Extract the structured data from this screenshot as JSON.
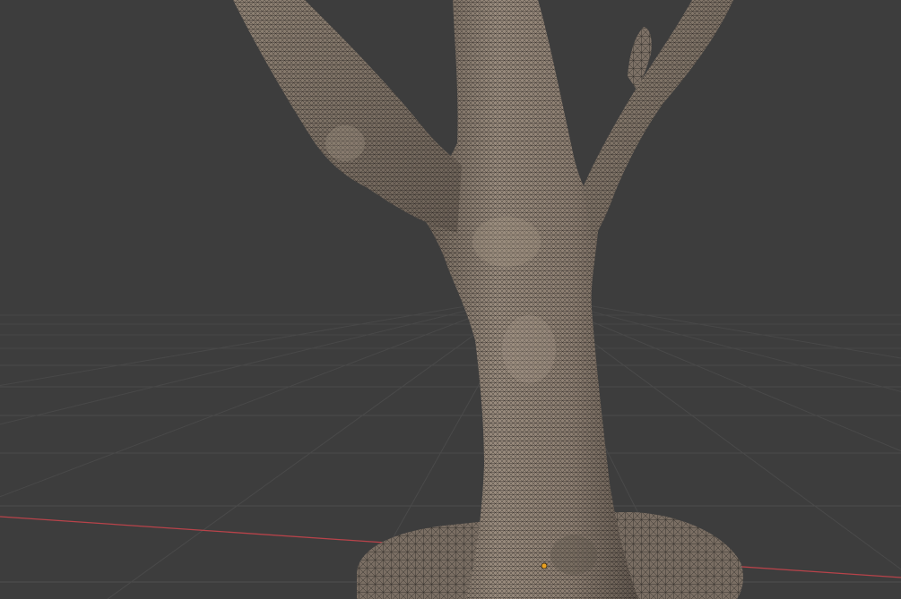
{
  "viewport": {
    "mode": "3d-viewport",
    "shading": "wireframe-overlay",
    "background_color": "#3d3d3d",
    "grid_color": "#4a4a4a",
    "x_axis_color": "#b8434a",
    "mesh_color": "#958677",
    "wire_color": "#1a1816",
    "origin_color": "#e8a021"
  },
  "scene": {
    "object": "tree-trunk-scan-mesh",
    "selected": true,
    "origin_visible": true
  }
}
